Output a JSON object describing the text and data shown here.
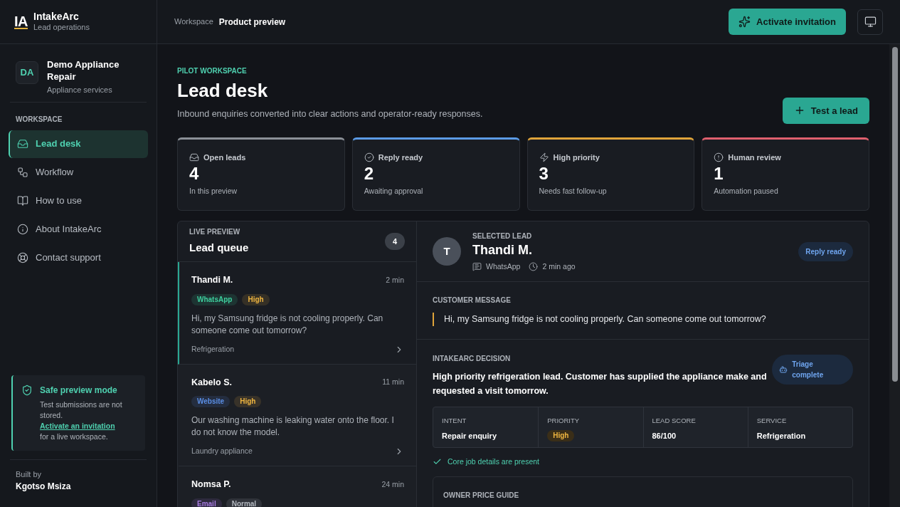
{
  "brand": {
    "logo": "IA",
    "name": "IntakeArc",
    "subtitle": "Lead operations"
  },
  "breadcrumb": {
    "parent": "Workspace",
    "current": "Product preview"
  },
  "header_actions": {
    "primary": "Activate invitation"
  },
  "business": {
    "initials": "DA",
    "name": "Demo Appliance Repair",
    "category": "Appliance services"
  },
  "sidebar": {
    "section": "WORKSPACE",
    "items": [
      {
        "label": "Lead desk",
        "selected": true
      },
      {
        "label": "Workflow",
        "selected": false
      },
      {
        "label": "How to use",
        "selected": false
      },
      {
        "label": "About IntakeArc",
        "selected": false
      },
      {
        "label": "Contact support",
        "selected": false
      }
    ]
  },
  "notice": {
    "title": "Safe preview mode",
    "text": "Test submissions are not stored.",
    "link": "Activate an invitation",
    "link_suffix": "for a live workspace."
  },
  "footer": {
    "label": "Built by",
    "author": "Kgotso Msiza"
  },
  "page": {
    "eyebrow": "PILOT WORKSPACE",
    "title": "Lead desk",
    "subtitle": "Inbound enquiries converted into clear actions and operator-ready responses.",
    "action": "Test a lead"
  },
  "stats": [
    {
      "label": "Open leads",
      "value": "4",
      "note": "In this preview",
      "color": "#8b9097"
    },
    {
      "label": "Reply ready",
      "value": "2",
      "note": "Awaiting approval",
      "color": "#5b9be6"
    },
    {
      "label": "High priority",
      "value": "3",
      "note": "Needs fast follow-up",
      "color": "#e0a43a"
    },
    {
      "label": "Human review",
      "value": "1",
      "note": "Automation paused",
      "color": "#e0606e"
    }
  ],
  "queue": {
    "eyebrow": "LIVE PREVIEW",
    "title": "Lead queue",
    "count": "4",
    "leads": [
      {
        "name": "Thandi M.",
        "time": "2 min",
        "selected": true,
        "tags": [
          {
            "label": "WhatsApp",
            "color": "#3ecf9e"
          },
          {
            "label": "High",
            "color": "#f0b640"
          }
        ],
        "message": "Hi, my Samsung fridge is not cooling properly. Can someone come out tomorrow?",
        "service": "Refrigeration"
      },
      {
        "name": "Kabelo S.",
        "time": "11 min",
        "selected": false,
        "tags": [
          {
            "label": "Website",
            "color": "#5b8fe6"
          },
          {
            "label": "High",
            "color": "#f0b640"
          }
        ],
        "message": "Our washing machine is leaking water onto the floor. I do not know the model.",
        "service": "Laundry appliance"
      },
      {
        "name": "Nomsa P.",
        "time": "24 min",
        "selected": false,
        "tags": [
          {
            "label": "Email",
            "color": "#a77be0"
          },
          {
            "label": "Normal",
            "color": "#b4b9c0"
          }
        ]
      }
    ]
  },
  "detail": {
    "eyebrow": "SELECTED LEAD",
    "initial": "T",
    "name": "Thandi M.",
    "channel": "WhatsApp",
    "time": "2 min ago",
    "status": "Reply ready",
    "message_label": "CUSTOMER MESSAGE",
    "message": "Hi, my Samsung fridge is not cooling properly. Can someone come out tomorrow?",
    "decision_label": "INTAKEARC DECISION",
    "decision_badge": "Triage complete",
    "decision": "High priority refrigeration lead. Customer has supplied the appliance make and requested a visit tomorrow.",
    "facts": [
      {
        "label": "INTENT",
        "value": "Repair enquiry",
        "kind": "text"
      },
      {
        "label": "PRIORITY",
        "value": "High",
        "kind": "badge"
      },
      {
        "label": "LEAD SCORE",
        "value": "86/100",
        "kind": "text"
      },
      {
        "label": "SERVICE",
        "value": "Refrigeration",
        "kind": "text"
      }
    ],
    "check": "Core job details are present",
    "price_label": "OWNER PRICE GUIDE"
  }
}
